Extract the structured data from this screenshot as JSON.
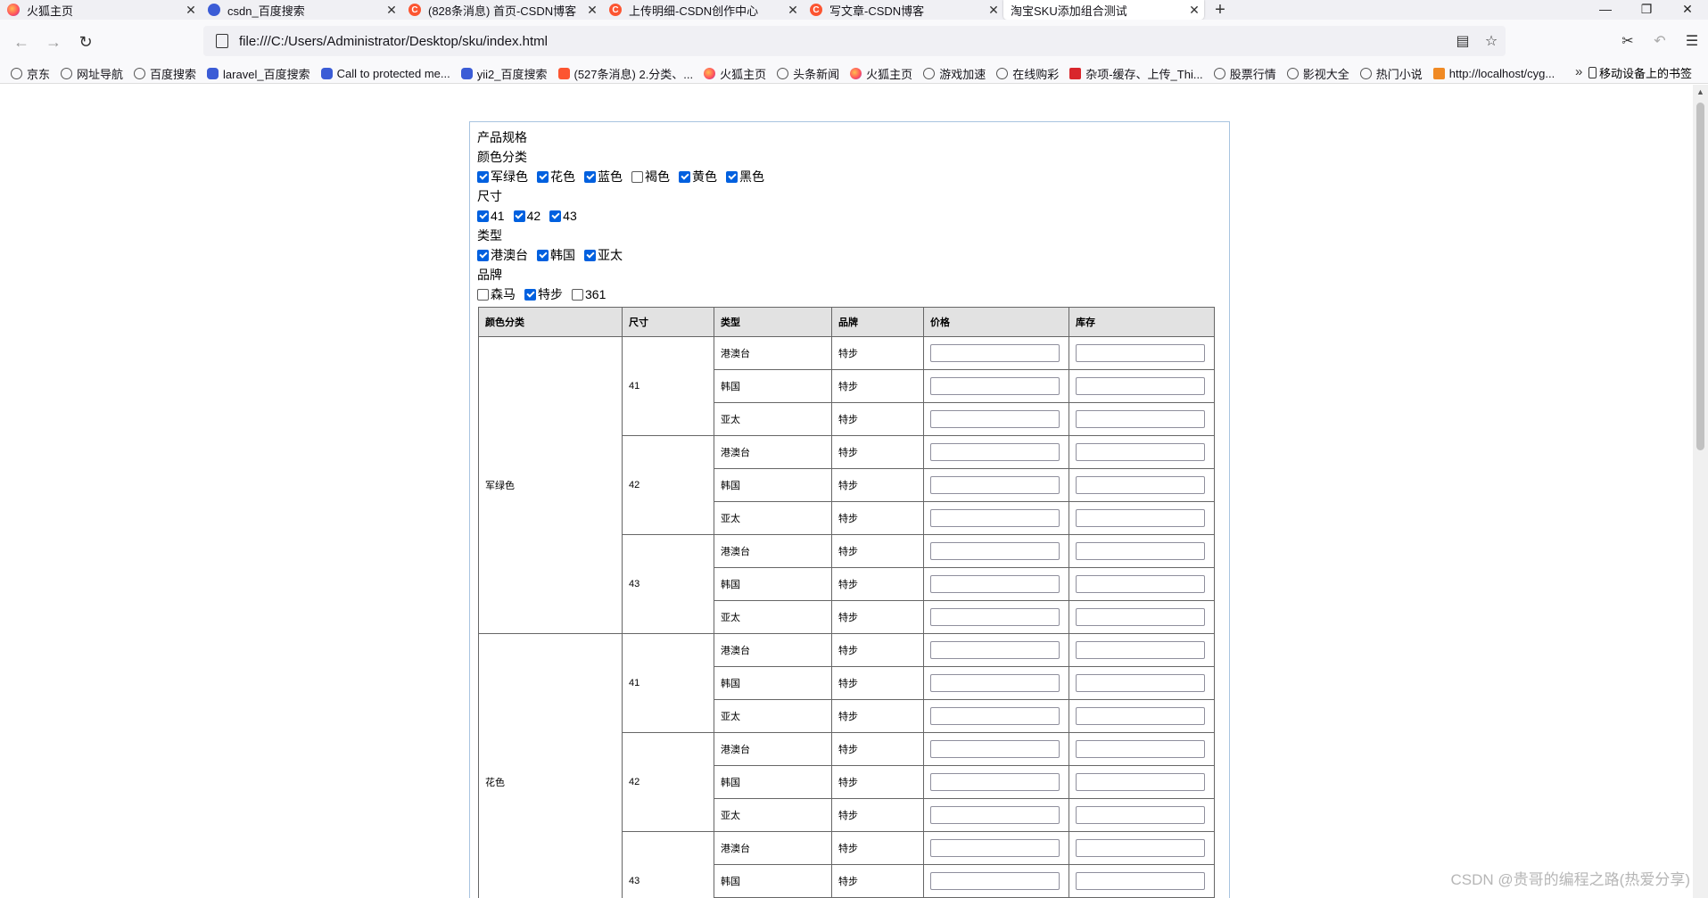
{
  "tabs": [
    {
      "title": "火狐主页",
      "icon": "firefox-icon"
    },
    {
      "title": "csdn_百度搜索",
      "icon": "baidu-paw-icon"
    },
    {
      "title": "(828条消息) 首页-CSDN博客",
      "icon": "csdn-icon"
    },
    {
      "title": "上传明细-CSDN创作中心",
      "icon": "csdn-icon"
    },
    {
      "title": "写文章-CSDN博客",
      "icon": "csdn-icon"
    },
    {
      "title": "淘宝SKU添加组合测试",
      "icon": "none"
    }
  ],
  "url": "file:///C:/Users/Administrator/Desktop/sku/index.html",
  "bookmarks": [
    {
      "label": "京东",
      "icon": "globe"
    },
    {
      "label": "网址导航",
      "icon": "globe"
    },
    {
      "label": "百度搜索",
      "icon": "globe"
    },
    {
      "label": "laravel_百度搜索",
      "icon": "paw"
    },
    {
      "label": "Call to protected me...",
      "icon": "paw"
    },
    {
      "label": "yii2_百度搜索",
      "icon": "paw"
    },
    {
      "label": "(527条消息) 2.分类、...",
      "icon": "csdn"
    },
    {
      "label": "火狐主页",
      "icon": "fox"
    },
    {
      "label": "头条新闻",
      "icon": "globe"
    },
    {
      "label": "火狐主页",
      "icon": "fox"
    },
    {
      "label": "游戏加速",
      "icon": "globe"
    },
    {
      "label": "在线购彩",
      "icon": "globe"
    },
    {
      "label": "杂项-缓存、上传_Thi...",
      "icon": "red"
    },
    {
      "label": "股票行情",
      "icon": "globe"
    },
    {
      "label": "影视大全",
      "icon": "globe"
    },
    {
      "label": "热门小说",
      "icon": "globe"
    },
    {
      "label": "http://localhost/cyg...",
      "icon": "orange"
    }
  ],
  "bookmarks_mobile": "移动设备上的书签",
  "panel": {
    "title": "产品规格",
    "groups": [
      {
        "name": "颜色分类",
        "options": [
          {
            "label": "军绿色",
            "checked": true
          },
          {
            "label": "花色",
            "checked": true
          },
          {
            "label": "蓝色",
            "checked": true
          },
          {
            "label": "褐色",
            "checked": false
          },
          {
            "label": "黄色",
            "checked": true
          },
          {
            "label": "黑色",
            "checked": true
          }
        ]
      },
      {
        "name": "尺寸",
        "options": [
          {
            "label": "41",
            "checked": true
          },
          {
            "label": "42",
            "checked": true
          },
          {
            "label": "43",
            "checked": true
          }
        ]
      },
      {
        "name": "类型",
        "options": [
          {
            "label": "港澳台",
            "checked": true
          },
          {
            "label": "韩国",
            "checked": true
          },
          {
            "label": "亚太",
            "checked": true
          }
        ]
      },
      {
        "name": "品牌",
        "options": [
          {
            "label": "森马",
            "checked": false
          },
          {
            "label": "特步",
            "checked": true
          },
          {
            "label": "361",
            "checked": false
          }
        ]
      }
    ]
  },
  "table": {
    "headers": [
      "颜色分类",
      "尺寸",
      "类型",
      "品牌",
      "价格",
      "库存"
    ],
    "colors": [
      "军绿色",
      "花色"
    ],
    "sizes": [
      "41",
      "42",
      "43"
    ],
    "types": [
      "港澳台",
      "韩国",
      "亚太"
    ],
    "brand": "特步"
  },
  "watermark": "CSDN @贵哥的编程之路(热爱分享)"
}
